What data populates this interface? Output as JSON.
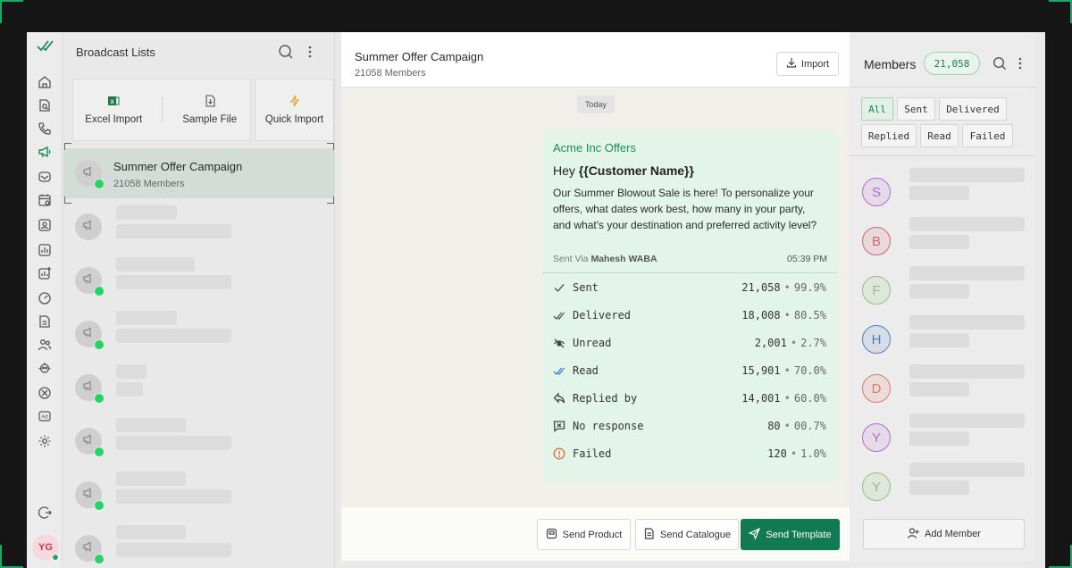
{
  "rail": {
    "user_initials": "YG",
    "brand_color": "#1a8a5a",
    "icons": [
      "home-icon",
      "search-orders-icon",
      "phone-icon",
      "broadcast-icon",
      "inbox-icon",
      "calendar-icon",
      "contacts-icon",
      "reports-icon",
      "analytics-icon",
      "dashboard-icon",
      "documents-icon",
      "team-icon",
      "bot-icon",
      "support-icon",
      "ads-icon",
      "settings-icon",
      "logout-icon"
    ]
  },
  "lists": {
    "title": "Broadcast Lists",
    "import_options": [
      {
        "label": "Excel Import",
        "icon": "excel-icon"
      },
      {
        "label": "Sample File",
        "icon": "download-file-icon"
      },
      {
        "label": "Quick Import",
        "icon": "lightning-icon"
      }
    ],
    "items": [
      {
        "title": "Summer Offer Campaign",
        "subtitle": "21058 Members",
        "active": true
      }
    ]
  },
  "chat": {
    "title": "Summer Offer Campaign",
    "subtitle": "21058 Members",
    "import_label": "Import",
    "date_chip": "Today",
    "message": {
      "sender": "Acme Inc Offers",
      "greeting_prefix": "Hey ",
      "greeting_var": "{{Customer Name}}",
      "body": "Our Summer Blowout Sale is here! To personalize your offers, what dates work best, how many in your party, and what's your destination and preferred activity level?",
      "sent_via_label": "Sent Via",
      "sent_via_account": "Mahesh WABA",
      "time": "05:39 PM"
    },
    "stats": [
      {
        "label": "Sent",
        "count": "21,058",
        "pct": "99.9%",
        "icon": "check-icon"
      },
      {
        "label": "Delivered",
        "count": "18,008",
        "pct": "80.5%",
        "icon": "double-check-icon"
      },
      {
        "label": "Unread",
        "count": "2,001",
        "pct": "2.7%",
        "icon": "eye-off-icon"
      },
      {
        "label": "Read",
        "count": "15,901",
        "pct": "70.0%",
        "icon": "double-check-blue-icon"
      },
      {
        "label": "Replied by",
        "count": "14,001",
        "pct": "60.0%",
        "icon": "reply-icon"
      },
      {
        "label": "No response",
        "count": "80",
        "pct": "00.7%",
        "icon": "no-response-icon"
      },
      {
        "label": "Failed",
        "count": "120",
        "pct": "1.0%",
        "icon": "alert-icon"
      }
    ],
    "footer": {
      "send_product": "Send Product",
      "send_catalogue": "Send Catalogue",
      "send_template": "Send Template"
    }
  },
  "members": {
    "title": "Members",
    "count": "21,058",
    "filters": [
      "All",
      "Sent",
      "Delivered",
      "Replied",
      "Read",
      "Failed"
    ],
    "active_filter": "All",
    "avatars": [
      {
        "letter": "S",
        "color": "#b36ad4"
      },
      {
        "letter": "B",
        "color": "#d4646f"
      },
      {
        "letter": "F",
        "color": "#8fc27a"
      },
      {
        "letter": "H",
        "color": "#4f7fc0"
      },
      {
        "letter": "D",
        "color": "#e07a6a"
      },
      {
        "letter": "Y",
        "color": "#b36ad4"
      },
      {
        "letter": "Y",
        "color": "#8fc27a"
      }
    ],
    "add_member_label": "Add Member"
  }
}
